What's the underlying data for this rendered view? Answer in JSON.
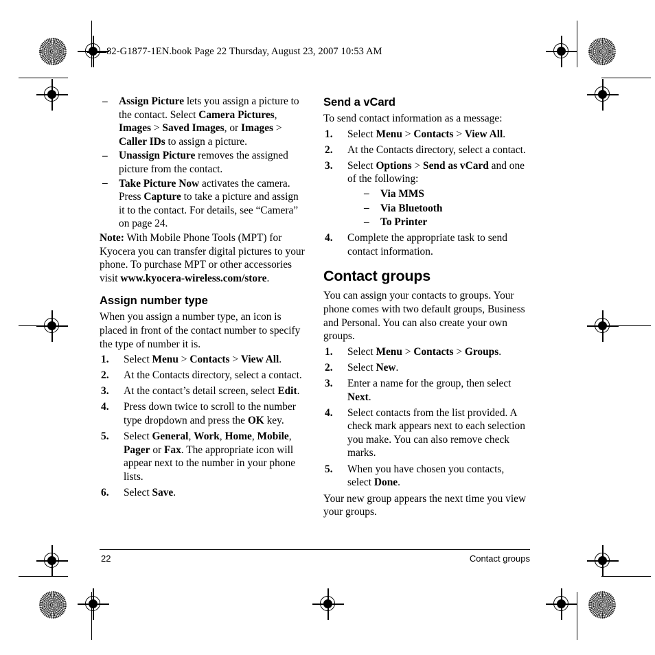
{
  "header": {
    "book_line": "82-G1877-1EN.book  Page 22  Thursday, August 23, 2007  10:53 AM"
  },
  "left_column": {
    "bullets": [
      {
        "id": "assign-picture",
        "segments": [
          {
            "t": "Assign Picture",
            "b": true
          },
          {
            "t": " lets you assign a picture to the contact. Select ",
            "b": false
          },
          {
            "t": "Camera Pictures",
            "b": true
          },
          {
            "t": ", ",
            "b": false
          },
          {
            "t": "Images",
            "b": true
          },
          {
            "t": " > ",
            "b": false
          },
          {
            "t": "Saved Images",
            "b": true
          },
          {
            "t": ", or ",
            "b": false
          },
          {
            "t": "Images",
            "b": true
          },
          {
            "t": " > ",
            "b": false
          },
          {
            "t": "Caller IDs",
            "b": true
          },
          {
            "t": " to assign a picture.",
            "b": false
          }
        ]
      },
      {
        "id": "unassign-picture",
        "segments": [
          {
            "t": "Unassign Picture",
            "b": true
          },
          {
            "t": " removes the assigned picture from the contact.",
            "b": false
          }
        ]
      },
      {
        "id": "take-picture-now",
        "segments": [
          {
            "t": "Take Picture Now",
            "b": true
          },
          {
            "t": " activates the camera. Press ",
            "b": false
          },
          {
            "t": "Capture",
            "b": true
          },
          {
            "t": " to take a picture and assign it to the contact. For details, see “Camera” on page 24.",
            "b": false
          }
        ]
      }
    ],
    "note": {
      "segments": [
        {
          "t": "Note:",
          "b": true
        },
        {
          "t": " With Mobile Phone Tools (MPT) for Kyocera you can transfer digital pictures to your phone. To purchase MPT or other accessories visit ",
          "b": false
        },
        {
          "t": "www.kyocera-wireless.com/store",
          "b": true
        },
        {
          "t": ".",
          "b": false
        }
      ]
    },
    "heading": "Assign number type",
    "intro": "When you assign a number type, an icon is placed in front of the contact number to specify the type of number it is.",
    "steps": [
      {
        "num": "1.",
        "segments": [
          {
            "t": "Select ",
            "b": false
          },
          {
            "t": "Menu",
            "b": true
          },
          {
            "t": " > ",
            "b": false
          },
          {
            "t": "Contacts",
            "b": true
          },
          {
            "t": " > ",
            "b": false
          },
          {
            "t": "View All",
            "b": true
          },
          {
            "t": ".",
            "b": false
          }
        ]
      },
      {
        "num": "2.",
        "segments": [
          {
            "t": "At the Contacts directory, select a contact.",
            "b": false
          }
        ]
      },
      {
        "num": "3.",
        "segments": [
          {
            "t": "At the contact’s detail screen, select ",
            "b": false
          },
          {
            "t": "Edit",
            "b": true
          },
          {
            "t": ".",
            "b": false
          }
        ]
      },
      {
        "num": "4.",
        "segments": [
          {
            "t": "Press down twice to scroll to the number type dropdown and press the ",
            "b": false
          },
          {
            "t": "OK",
            "b": true
          },
          {
            "t": " key.",
            "b": false
          }
        ]
      },
      {
        "num": "5.",
        "segments": [
          {
            "t": "Select ",
            "b": false
          },
          {
            "t": "General",
            "b": true
          },
          {
            "t": ", ",
            "b": false
          },
          {
            "t": "Work",
            "b": true
          },
          {
            "t": ", ",
            "b": false
          },
          {
            "t": "Home",
            "b": true
          },
          {
            "t": ", ",
            "b": false
          },
          {
            "t": "Mobile",
            "b": true
          },
          {
            "t": ", ",
            "b": false
          },
          {
            "t": "Pager",
            "b": true
          },
          {
            "t": " or ",
            "b": false
          },
          {
            "t": "Fax",
            "b": true
          },
          {
            "t": ". The appropriate icon will appear next to the number in your phone lists.",
            "b": false
          }
        ]
      },
      {
        "num": "6.",
        "segments": [
          {
            "t": "Select ",
            "b": false
          },
          {
            "t": "Save",
            "b": true
          },
          {
            "t": ".",
            "b": false
          }
        ]
      }
    ]
  },
  "right_column": {
    "vcard_heading": "Send a vCard",
    "vcard_intro": "To send contact information as a message:",
    "vcard_steps": [
      {
        "num": "1.",
        "segments": [
          {
            "t": "Select ",
            "b": false
          },
          {
            "t": "Menu",
            "b": true
          },
          {
            "t": " > ",
            "b": false
          },
          {
            "t": "Contacts",
            "b": true
          },
          {
            "t": " > ",
            "b": false
          },
          {
            "t": "View All",
            "b": true
          },
          {
            "t": ".",
            "b": false
          }
        ]
      },
      {
        "num": "2.",
        "segments": [
          {
            "t": "At the Contacts directory, select a contact.",
            "b": false
          }
        ]
      },
      {
        "num": "3.",
        "segments": [
          {
            "t": "Select ",
            "b": false
          },
          {
            "t": "Options",
            "b": true
          },
          {
            "t": " > ",
            "b": false
          },
          {
            "t": "Send as vCard",
            "b": true
          },
          {
            "t": " and one of the following:",
            "b": false
          }
        ],
        "sub_items": [
          "Via MMS",
          "Via Bluetooth",
          "To Printer"
        ]
      },
      {
        "num": "4.",
        "segments": [
          {
            "t": "Complete the appropriate task to send contact information.",
            "b": false
          }
        ]
      }
    ],
    "groups_heading": "Contact groups",
    "groups_intro": "You can assign your contacts to groups. Your phone comes with two default groups, Business and Personal. You can also create your own groups.",
    "groups_steps": [
      {
        "num": "1.",
        "segments": [
          {
            "t": "Select ",
            "b": false
          },
          {
            "t": "Menu",
            "b": true
          },
          {
            "t": " > ",
            "b": false
          },
          {
            "t": "Contacts",
            "b": true
          },
          {
            "t": " > ",
            "b": false
          },
          {
            "t": "Groups",
            "b": true
          },
          {
            "t": ".",
            "b": false
          }
        ]
      },
      {
        "num": "2.",
        "segments": [
          {
            "t": "Select ",
            "b": false
          },
          {
            "t": "New",
            "b": true
          },
          {
            "t": ".",
            "b": false
          }
        ]
      },
      {
        "num": "3.",
        "segments": [
          {
            "t": "Enter a name for the group, then select ",
            "b": false
          },
          {
            "t": "Next",
            "b": true
          },
          {
            "t": ".",
            "b": false
          }
        ]
      },
      {
        "num": "4.",
        "segments": [
          {
            "t": "Select contacts from the list provided. A check mark appears next to each selection you make. You can also remove check marks.",
            "b": false
          }
        ]
      },
      {
        "num": "5.",
        "segments": [
          {
            "t": "When you have chosen you contacts, select ",
            "b": false
          },
          {
            "t": "Done",
            "b": true
          },
          {
            "t": ".",
            "b": false
          }
        ]
      }
    ],
    "groups_outro": "Your new group appears the next time you view your groups."
  },
  "footer": {
    "page_number": "22",
    "section_title": "Contact groups"
  }
}
